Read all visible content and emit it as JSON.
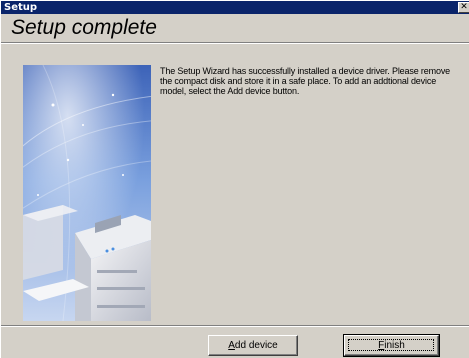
{
  "window": {
    "title": "Setup",
    "close_glyph": "✕"
  },
  "header": {
    "title": "Setup complete"
  },
  "body": {
    "message": "The Setup Wizard has successfully installed a device driver. Please remove the compact disk and store it in a safe place. To add an addtional device model, select the Add device button."
  },
  "buttons": {
    "add_device": {
      "label_underlined": "A",
      "label_rest": "dd device"
    },
    "finish": {
      "label_underlined": "F",
      "label_rest": "inish"
    }
  },
  "illustration": {
    "icon": "printer-image"
  },
  "colors": {
    "titlebar": "#0a246a",
    "face": "#d4d0c8",
    "sky": "#6f93d6"
  }
}
